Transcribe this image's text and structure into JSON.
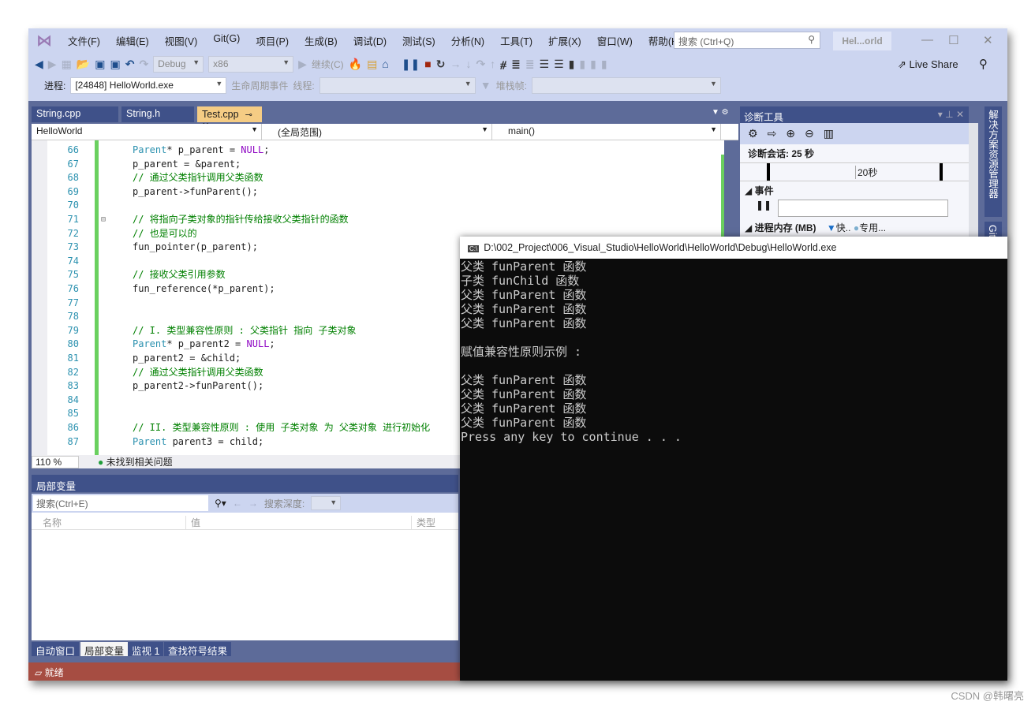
{
  "menu": {
    "items": [
      "文件(F)",
      "编辑(E)",
      "视图(V)",
      "Git(G)",
      "项目(P)",
      "生成(B)",
      "调试(D)",
      "测试(S)",
      "分析(N)",
      "工具(T)",
      "扩展(X)",
      "窗口(W)",
      "帮助(H)"
    ],
    "search_placeholder": "搜索 (Ctrl+Q)",
    "window_title": "Hel...orld"
  },
  "toolbar": {
    "config": "Debug",
    "platform": "x86",
    "continue": "继续(C)",
    "live_share": "Live Share",
    "process_label": "进程:",
    "process": "[24848] HelloWorld.exe",
    "lifecycle": "生命周期事件",
    "thread_label": "线程:",
    "stack_label": "堆栈帧:"
  },
  "tabs": [
    {
      "label": "String.cpp"
    },
    {
      "label": "String.h"
    },
    {
      "label": "Test.cpp",
      "active": true
    }
  ],
  "nav": {
    "project": "HelloWorld",
    "scope": "(全局范围)",
    "member": "main()"
  },
  "editor": {
    "zoom": "110 %",
    "issues": "未找到相关问题",
    "lines": [
      {
        "n": "66",
        "parts": [
          [
            "Parent",
            "ty"
          ],
          [
            "* p_parent = ",
            "pl"
          ],
          [
            "NULL",
            "mac"
          ],
          [
            ";",
            "pl"
          ]
        ]
      },
      {
        "n": "67",
        "parts": [
          [
            "p_parent = &parent;",
            "pl"
          ]
        ]
      },
      {
        "n": "68",
        "parts": [
          [
            "// 通过父类指针调用父类函数",
            "cm"
          ]
        ]
      },
      {
        "n": "69",
        "parts": [
          [
            "p_parent->funParent();",
            "pl"
          ]
        ]
      },
      {
        "n": "70",
        "parts": []
      },
      {
        "n": "71",
        "parts": [
          [
            "// 将指向子类对象的指针传给接收父类指针的函数",
            "cm"
          ]
        ],
        "fold": true
      },
      {
        "n": "72",
        "parts": [
          [
            "// 也是可以的",
            "cm"
          ]
        ]
      },
      {
        "n": "73",
        "parts": [
          [
            "fun_pointer(p_parent);",
            "pl"
          ]
        ]
      },
      {
        "n": "74",
        "parts": []
      },
      {
        "n": "75",
        "parts": [
          [
            "// 接收父类引用参数",
            "cm"
          ]
        ]
      },
      {
        "n": "76",
        "parts": [
          [
            "fun_reference(*p_parent);",
            "pl"
          ]
        ]
      },
      {
        "n": "77",
        "parts": []
      },
      {
        "n": "78",
        "parts": []
      },
      {
        "n": "79",
        "parts": [
          [
            "// I. 类型兼容性原则 : 父类指针 指向 子类对象",
            "cm"
          ]
        ]
      },
      {
        "n": "80",
        "parts": [
          [
            "Parent",
            "ty"
          ],
          [
            "* p_parent2 = ",
            "pl"
          ],
          [
            "NULL",
            "mac"
          ],
          [
            ";",
            "pl"
          ]
        ]
      },
      {
        "n": "81",
        "parts": [
          [
            "p_parent2 = &child;",
            "pl"
          ]
        ]
      },
      {
        "n": "82",
        "parts": [
          [
            "// 通过父类指针调用父类函数",
            "cm"
          ]
        ]
      },
      {
        "n": "83",
        "parts": [
          [
            "p_parent2->funParent();",
            "pl"
          ]
        ]
      },
      {
        "n": "84",
        "parts": []
      },
      {
        "n": "85",
        "parts": []
      },
      {
        "n": "86",
        "parts": [
          [
            "// II. 类型兼容性原则 : 使用 子类对象 为 父类对象 进行初始化",
            "cm"
          ]
        ]
      },
      {
        "n": "87",
        "parts": [
          [
            "Parent",
            "ty"
          ],
          [
            " parent3 = child;",
            "pl"
          ]
        ]
      }
    ]
  },
  "locals": {
    "title": "局部变量",
    "search_placeholder": "搜索(Ctrl+E)",
    "depth_label": "搜索深度:",
    "columns": [
      "名称",
      "值",
      "类型"
    ],
    "tabs": [
      "自动窗口",
      "局部变量",
      "监视 1",
      "查找符号结果"
    ]
  },
  "status": {
    "text": "就绪"
  },
  "diag": {
    "title": "诊断工具",
    "session": "诊断会话: 25 秒",
    "tick": "20秒",
    "events": "事件",
    "memory": "进程内存 (MB)",
    "legend_fast": "快..",
    "legend_private": "专用..."
  },
  "side_tabs": [
    "解决方案资源管理器",
    "Git 更改"
  ],
  "console": {
    "title": "D:\\002_Project\\006_Visual_Studio\\HelloWorld\\HelloWorld\\Debug\\HelloWorld.exe",
    "lines": [
      "父类 funParent 函数",
      "子类 funChild 函数",
      "父类 funParent 函数",
      "父类 funParent 函数",
      "父类 funParent 函数",
      "",
      "赋值兼容性原则示例 :",
      "",
      "父类 funParent 函数",
      "父类 funParent 函数",
      "父类 funParent 函数",
      "父类 funParent 函数",
      "Press any key to continue . . ."
    ]
  },
  "watermark": "CSDN @韩曙亮",
  "colors": {
    "accent": "#5d6b99",
    "active_tab": "#f5cc84",
    "status_bar": "#a64d42"
  }
}
